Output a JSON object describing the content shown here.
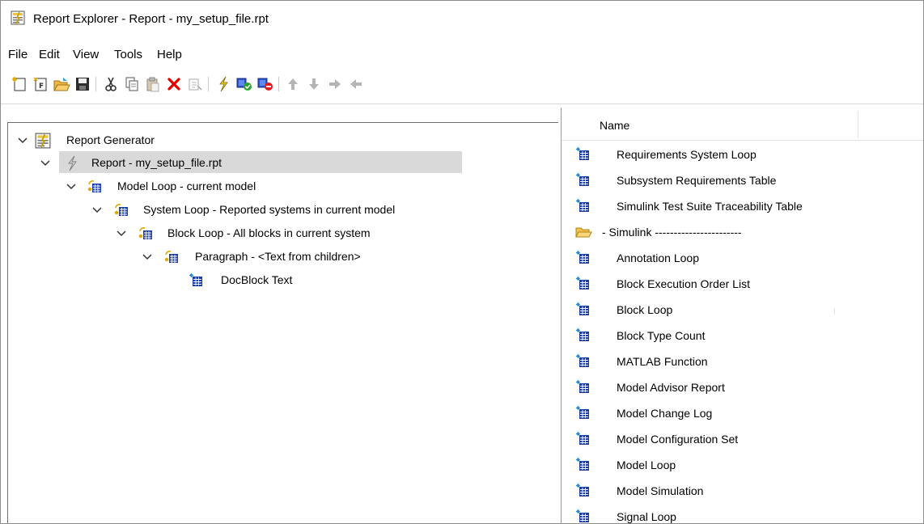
{
  "window": {
    "title": "Report Explorer - Report - my_setup_file.rpt",
    "icon": "report-explorer-icon"
  },
  "menu": [
    "File",
    "Edit",
    "View",
    "Tools",
    "Help"
  ],
  "toolbar": {
    "buttons": [
      {
        "name": "new-report-icon"
      },
      {
        "name": "new-form-icon"
      },
      {
        "name": "open-icon"
      },
      {
        "name": "save-icon"
      },
      {
        "name": "cut-icon"
      },
      {
        "name": "copy-icon"
      },
      {
        "name": "paste-icon"
      },
      {
        "name": "delete-icon",
        "color": "#e00000"
      },
      {
        "name": "activate-deactivate-icon"
      },
      {
        "name": "generate-report-icon"
      },
      {
        "name": "enable-component-icon"
      },
      {
        "name": "disable-component-icon"
      },
      {
        "name": "move-up-icon"
      },
      {
        "name": "move-down-icon"
      },
      {
        "name": "move-right-icon"
      },
      {
        "name": "move-left-icon"
      }
    ]
  },
  "tree": {
    "root": "Report Generator",
    "report": "Report - my_setup_file.rpt",
    "model_loop": "Model Loop - current model",
    "system_loop": "System Loop - Reported systems in current model",
    "block_loop": "Block Loop - All blocks in current system",
    "paragraph": "Paragraph - <Text from children>",
    "docblock": "DocBlock Text"
  },
  "list": {
    "column_name": "Name",
    "items": [
      "Requirements System Loop",
      "Subsystem Requirements Table",
      "Simulink Test Suite Traceability Table",
      "- Simulink -----------------------",
      "Annotation Loop",
      "Block Execution Order List",
      "Block Loop",
      "Block Type Count",
      "MATLAB Function",
      "Model Advisor Report",
      "Model Change Log",
      "Model Configuration Set",
      "Model Loop",
      "Model Simulation",
      "Signal Loop"
    ]
  },
  "colors": {
    "selection": "#d9d9d9",
    "icon_blue": "#1a3fa3",
    "folder": "#f2c14e",
    "lightning": "#e3b400"
  }
}
